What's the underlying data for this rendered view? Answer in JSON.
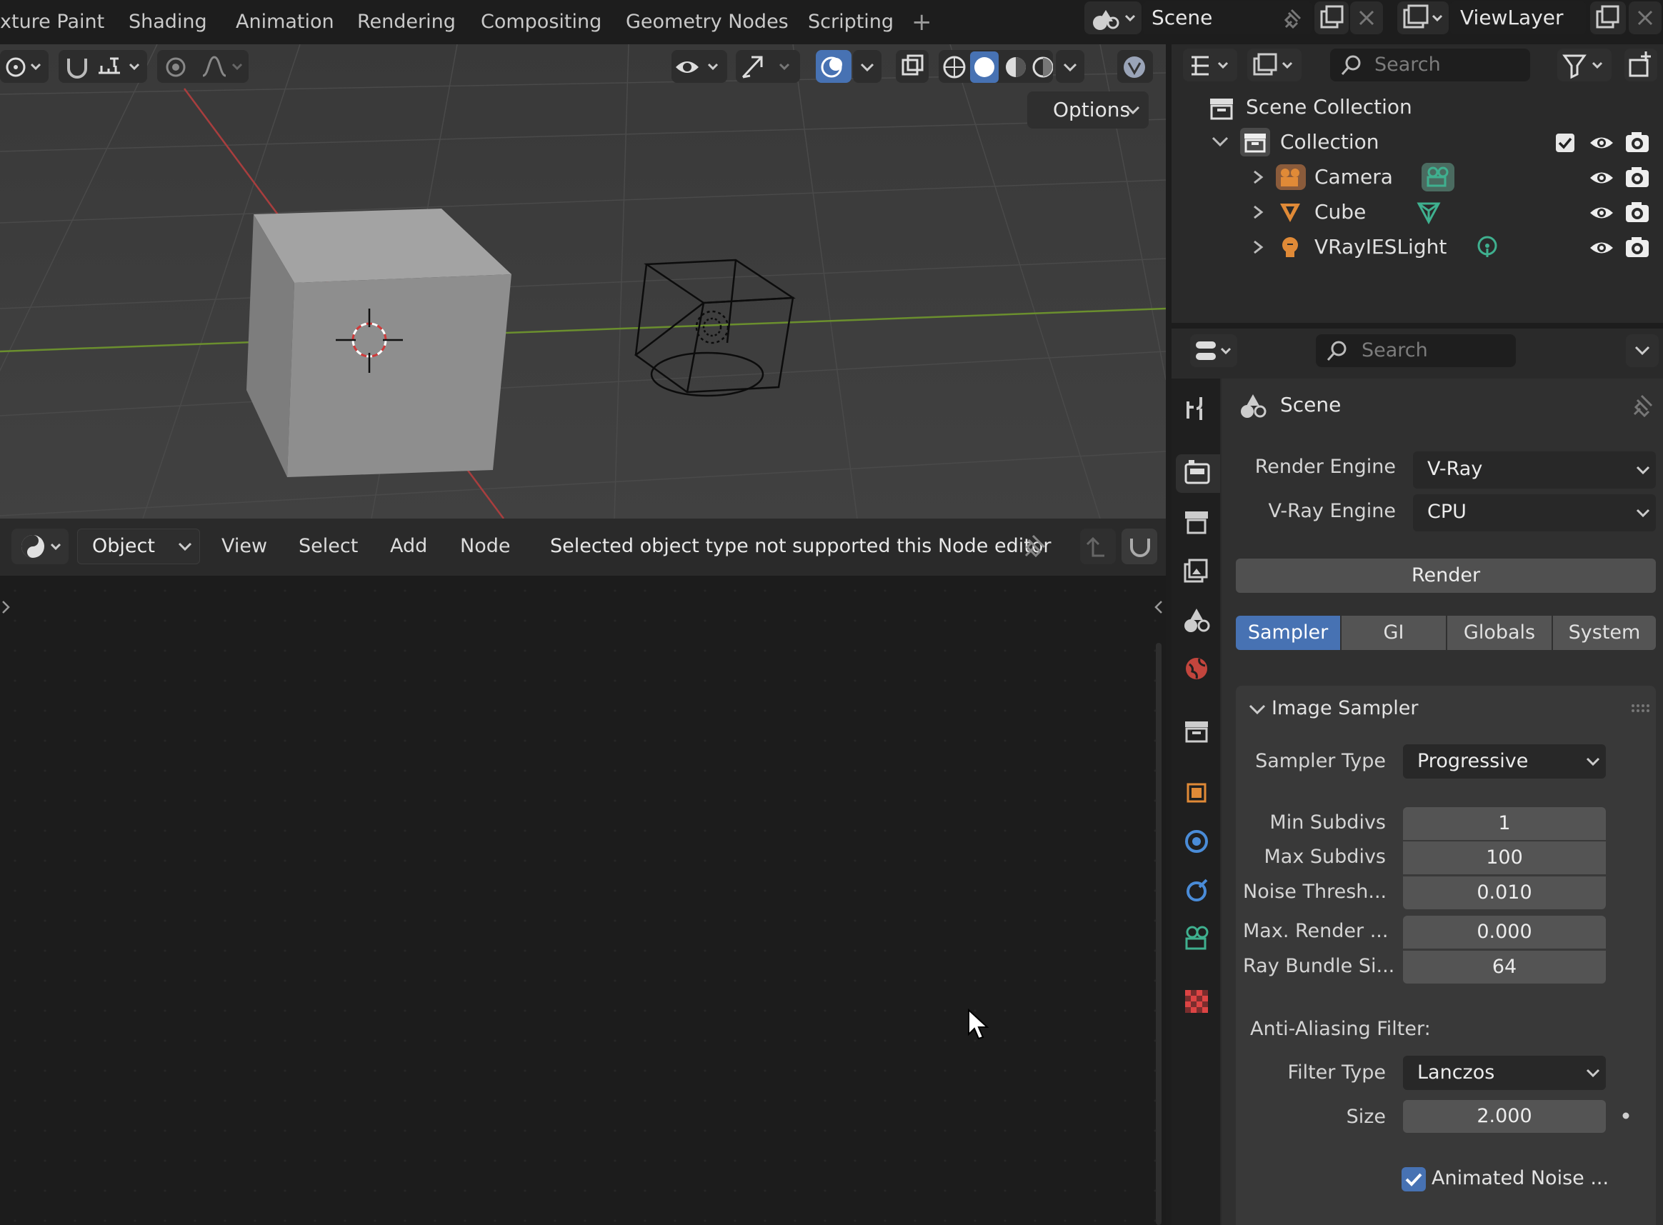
{
  "workspace_tabs": [
    "xture Paint",
    "Shading",
    "Animation",
    "Rendering",
    "Compositing",
    "Geometry Nodes",
    "Scripting"
  ],
  "add_workspace": "+",
  "scene": {
    "label": "Scene"
  },
  "view_layer": {
    "label": "ViewLayer"
  },
  "viewport": {
    "options_label": "Options"
  },
  "node_editor": {
    "mode": "Object",
    "menus": [
      "View",
      "Select",
      "Add",
      "Node"
    ],
    "message": "Selected object type not supported this Node editor"
  },
  "outliner": {
    "search_placeholder": "Search",
    "root": "Scene Collection",
    "collection": "Collection",
    "items": [
      "Camera",
      "Cube",
      "VRayIESLight"
    ]
  },
  "properties": {
    "search_placeholder": "Search",
    "context_title": "Scene",
    "render_engine_label": "Render Engine",
    "render_engine_value": "V-Ray",
    "vray_engine_label": "V-Ray Engine",
    "vray_engine_value": "CPU",
    "render_button": "Render",
    "tabs": [
      "Sampler",
      "GI",
      "Globals",
      "System"
    ],
    "active_tab": "Sampler",
    "panel_title": "Image Sampler",
    "sampler_type_label": "Sampler Type",
    "sampler_type_value": "Progressive",
    "fields": [
      {
        "label": "Min Subdivs",
        "value": "1"
      },
      {
        "label": "Max Subdivs",
        "value": "100"
      },
      {
        "label": "Noise Thresh...",
        "value": "0.010"
      },
      {
        "label": "Max. Render ...",
        "value": "0.000"
      },
      {
        "label": "Ray Bundle Si...",
        "value": "64"
      }
    ],
    "aa_heading": "Anti-Aliasing Filter:",
    "filter_type_label": "Filter Type",
    "filter_type_value": "Lanczos",
    "size_label": "Size",
    "size_value": "2.000",
    "animated_noise_label": "Animated Noise ...",
    "animated_noise_checked": true
  },
  "colors": {
    "accent": "#4772b3",
    "camera_green": "#3fb08f",
    "cube_orange": "#e08a37"
  }
}
